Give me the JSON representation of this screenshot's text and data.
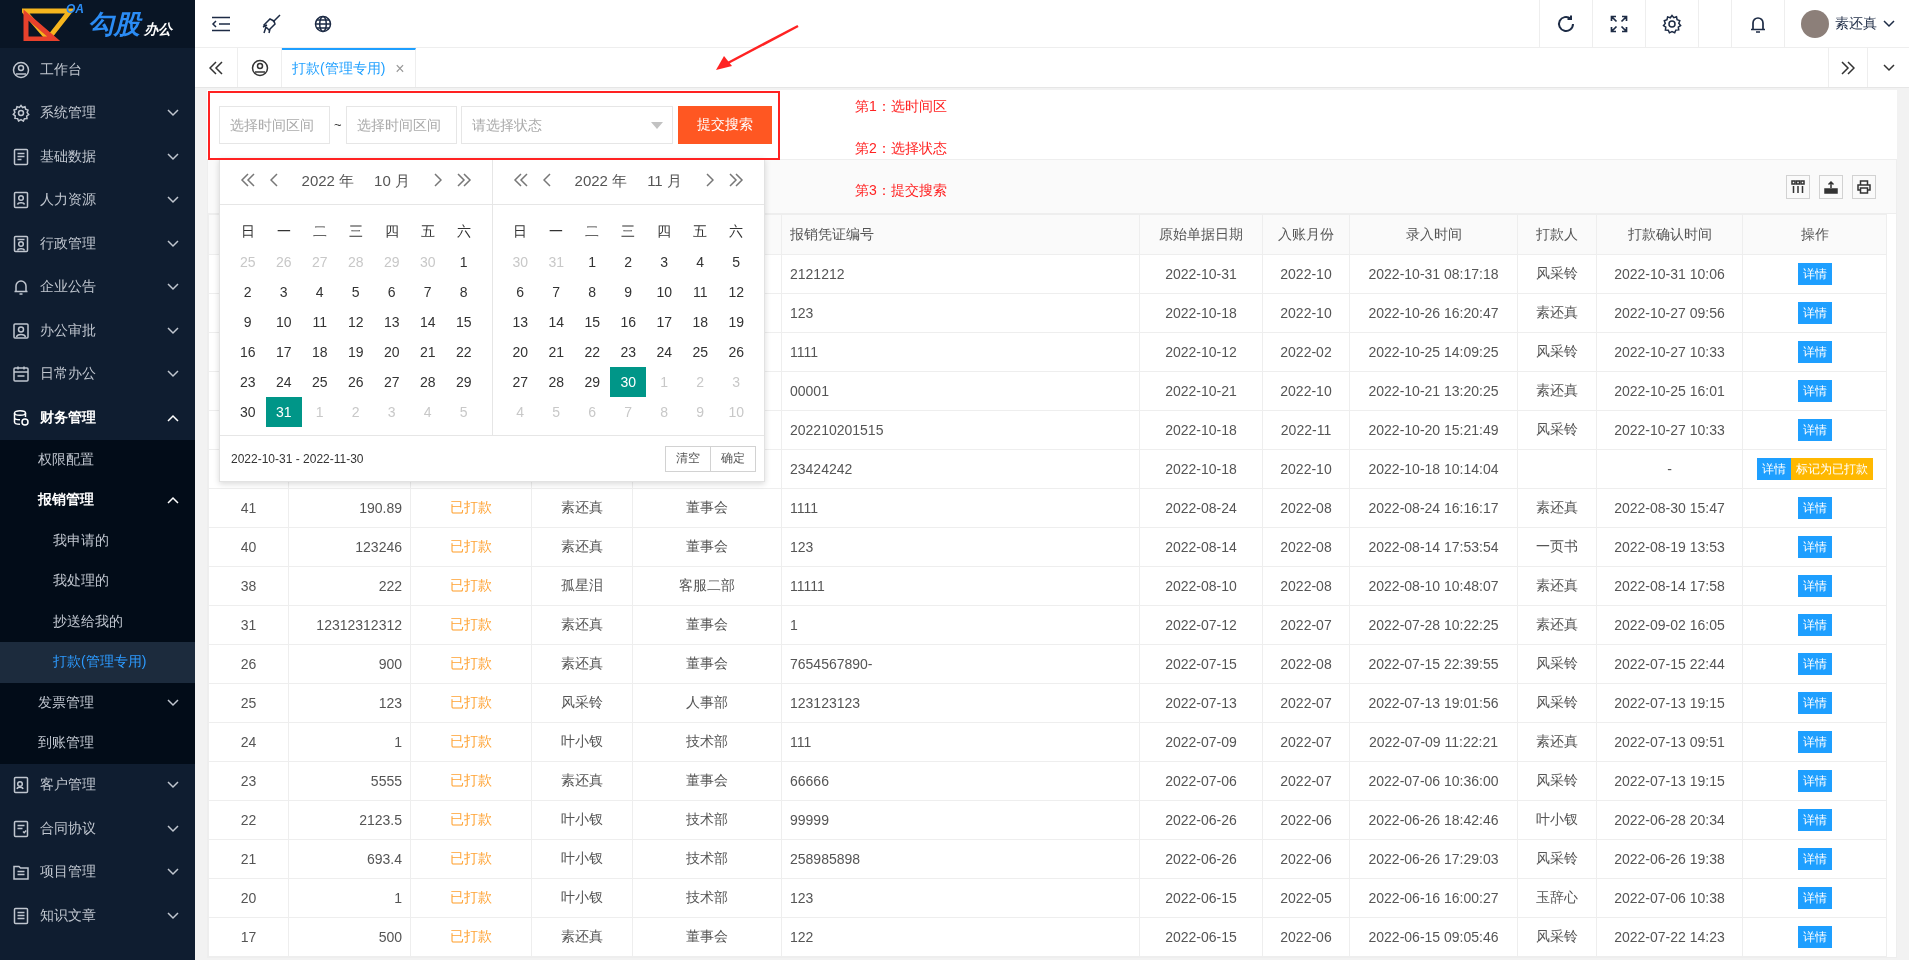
{
  "logo": {
    "superscript": "OA",
    "name": "勾股",
    "suffix": "办公"
  },
  "sidebar": {
    "items": [
      {
        "label": "工作台",
        "expandable": false,
        "expanded": false,
        "selected": false
      },
      {
        "label": "系统管理",
        "expandable": true,
        "expanded": false,
        "selected": false
      },
      {
        "label": "基础数据",
        "expandable": true,
        "expanded": false,
        "selected": false
      },
      {
        "label": "人力资源",
        "expandable": true,
        "expanded": false,
        "selected": false
      },
      {
        "label": "行政管理",
        "expandable": true,
        "expanded": false,
        "selected": false
      },
      {
        "label": "企业公告",
        "expandable": true,
        "expanded": false,
        "selected": false
      },
      {
        "label": "办公审批",
        "expandable": true,
        "expanded": false,
        "selected": false
      },
      {
        "label": "日常办公",
        "expandable": true,
        "expanded": false,
        "selected": false
      },
      {
        "label": "财务管理",
        "expandable": true,
        "expanded": true,
        "selected": false,
        "children": [
          {
            "label": "权限配置",
            "expandable": false,
            "expanded": false,
            "selected": false
          },
          {
            "label": "报销管理",
            "expandable": true,
            "expanded": true,
            "selected": false,
            "children": [
              {
                "label": "我申请的",
                "expandable": false,
                "expanded": false,
                "selected": false
              },
              {
                "label": "我处理的",
                "expandable": false,
                "expanded": false,
                "selected": false
              },
              {
                "label": "抄送给我的",
                "expandable": false,
                "expanded": false,
                "selected": false
              },
              {
                "label": "打款(管理专用)",
                "expandable": false,
                "expanded": false,
                "selected": true
              }
            ]
          },
          {
            "label": "发票管理",
            "expandable": true,
            "expanded": false,
            "selected": false
          },
          {
            "label": "到账管理",
            "expandable": false,
            "expanded": false,
            "selected": false
          }
        ]
      },
      {
        "label": "客户管理",
        "expandable": true,
        "expanded": false,
        "selected": false
      },
      {
        "label": "合同协议",
        "expandable": true,
        "expanded": false,
        "selected": false
      },
      {
        "label": "项目管理",
        "expandable": true,
        "expanded": false,
        "selected": false
      },
      {
        "label": "知识文章",
        "expandable": true,
        "expanded": false,
        "selected": false
      }
    ]
  },
  "header": {
    "user": "素还真"
  },
  "tabs": [
    {
      "label": "打款(管理专用)",
      "selected": true,
      "close": "×"
    }
  ],
  "search_form": {
    "start_placeholder": "选择时间区间",
    "separator": "~",
    "end_placeholder": "选择时间区间",
    "status_placeholder": "请选择状态",
    "submit": "提交搜索"
  },
  "date_picker": {
    "months": [
      {
        "year": "2022 年",
        "month": "10 月",
        "weekdays": [
          "日",
          "一",
          "二",
          "三",
          "四",
          "五",
          "六"
        ],
        "days": [
          {
            "t": "25",
            "muted": true,
            "selected": false
          },
          {
            "t": "26",
            "muted": true,
            "selected": false
          },
          {
            "t": "27",
            "muted": true,
            "selected": false
          },
          {
            "t": "28",
            "muted": true,
            "selected": false
          },
          {
            "t": "29",
            "muted": true,
            "selected": false
          },
          {
            "t": "30",
            "muted": true,
            "selected": false
          },
          {
            "t": "1",
            "muted": false,
            "selected": false
          },
          {
            "t": "2",
            "muted": false,
            "selected": false
          },
          {
            "t": "3",
            "muted": false,
            "selected": false
          },
          {
            "t": "4",
            "muted": false,
            "selected": false
          },
          {
            "t": "5",
            "muted": false,
            "selected": false
          },
          {
            "t": "6",
            "muted": false,
            "selected": false
          },
          {
            "t": "7",
            "muted": false,
            "selected": false
          },
          {
            "t": "8",
            "muted": false,
            "selected": false
          },
          {
            "t": "9",
            "muted": false,
            "selected": false
          },
          {
            "t": "10",
            "muted": false,
            "selected": false
          },
          {
            "t": "11",
            "muted": false,
            "selected": false
          },
          {
            "t": "12",
            "muted": false,
            "selected": false
          },
          {
            "t": "13",
            "muted": false,
            "selected": false
          },
          {
            "t": "14",
            "muted": false,
            "selected": false
          },
          {
            "t": "15",
            "muted": false,
            "selected": false
          },
          {
            "t": "16",
            "muted": false,
            "selected": false
          },
          {
            "t": "17",
            "muted": false,
            "selected": false
          },
          {
            "t": "18",
            "muted": false,
            "selected": false
          },
          {
            "t": "19",
            "muted": false,
            "selected": false
          },
          {
            "t": "20",
            "muted": false,
            "selected": false
          },
          {
            "t": "21",
            "muted": false,
            "selected": false
          },
          {
            "t": "22",
            "muted": false,
            "selected": false
          },
          {
            "t": "23",
            "muted": false,
            "selected": false
          },
          {
            "t": "24",
            "muted": false,
            "selected": false
          },
          {
            "t": "25",
            "muted": false,
            "selected": false
          },
          {
            "t": "26",
            "muted": false,
            "selected": false
          },
          {
            "t": "27",
            "muted": false,
            "selected": false
          },
          {
            "t": "28",
            "muted": false,
            "selected": false
          },
          {
            "t": "29",
            "muted": false,
            "selected": false
          },
          {
            "t": "30",
            "muted": false,
            "selected": false
          },
          {
            "t": "31",
            "muted": false,
            "selected": true
          },
          {
            "t": "1",
            "muted": true,
            "selected": false
          },
          {
            "t": "2",
            "muted": true,
            "selected": false
          },
          {
            "t": "3",
            "muted": true,
            "selected": false
          },
          {
            "t": "4",
            "muted": true,
            "selected": false
          },
          {
            "t": "5",
            "muted": true,
            "selected": false
          }
        ]
      },
      {
        "year": "2022 年",
        "month": "11 月",
        "weekdays": [
          "日",
          "一",
          "二",
          "三",
          "四",
          "五",
          "六"
        ],
        "days": [
          {
            "t": "30",
            "muted": true,
            "selected": false
          },
          {
            "t": "31",
            "muted": true,
            "selected": false
          },
          {
            "t": "1",
            "muted": false,
            "selected": false
          },
          {
            "t": "2",
            "muted": false,
            "selected": false
          },
          {
            "t": "3",
            "muted": false,
            "selected": false
          },
          {
            "t": "4",
            "muted": false,
            "selected": false
          },
          {
            "t": "5",
            "muted": false,
            "selected": false
          },
          {
            "t": "6",
            "muted": false,
            "selected": false
          },
          {
            "t": "7",
            "muted": false,
            "selected": false
          },
          {
            "t": "8",
            "muted": false,
            "selected": false
          },
          {
            "t": "9",
            "muted": false,
            "selected": false
          },
          {
            "t": "10",
            "muted": false,
            "selected": false
          },
          {
            "t": "11",
            "muted": false,
            "selected": false
          },
          {
            "t": "12",
            "muted": false,
            "selected": false
          },
          {
            "t": "13",
            "muted": false,
            "selected": false
          },
          {
            "t": "14",
            "muted": false,
            "selected": false
          },
          {
            "t": "15",
            "muted": false,
            "selected": false
          },
          {
            "t": "16",
            "muted": false,
            "selected": false
          },
          {
            "t": "17",
            "muted": false,
            "selected": false
          },
          {
            "t": "18",
            "muted": false,
            "selected": false
          },
          {
            "t": "19",
            "muted": false,
            "selected": false
          },
          {
            "t": "20",
            "muted": false,
            "selected": false
          },
          {
            "t": "21",
            "muted": false,
            "selected": false
          },
          {
            "t": "22",
            "muted": false,
            "selected": false
          },
          {
            "t": "23",
            "muted": false,
            "selected": false
          },
          {
            "t": "24",
            "muted": false,
            "selected": false
          },
          {
            "t": "25",
            "muted": false,
            "selected": false
          },
          {
            "t": "26",
            "muted": false,
            "selected": false
          },
          {
            "t": "27",
            "muted": false,
            "selected": false
          },
          {
            "t": "28",
            "muted": false,
            "selected": false
          },
          {
            "t": "29",
            "muted": false,
            "selected": false
          },
          {
            "t": "30",
            "muted": false,
            "selected": true
          },
          {
            "t": "1",
            "muted": true,
            "selected": false
          },
          {
            "t": "2",
            "muted": true,
            "selected": false
          },
          {
            "t": "3",
            "muted": true,
            "selected": false
          },
          {
            "t": "4",
            "muted": true,
            "selected": false
          },
          {
            "t": "5",
            "muted": true,
            "selected": false
          },
          {
            "t": "6",
            "muted": true,
            "selected": false
          },
          {
            "t": "7",
            "muted": true,
            "selected": false
          },
          {
            "t": "8",
            "muted": true,
            "selected": false
          },
          {
            "t": "9",
            "muted": true,
            "selected": false
          },
          {
            "t": "10",
            "muted": true,
            "selected": false
          }
        ]
      }
    ],
    "range": "2022-10-31 - 2022-11-30",
    "buttons": [
      "清空",
      "确定"
    ]
  },
  "annotations": [
    "第1：选时间区",
    "第2：选择状态",
    "第3：提交搜索"
  ],
  "table": {
    "columns": [
      "报销凭证编号",
      "原始单据日期",
      "入账月份",
      "录入时间",
      "打款人",
      "打款确认时间",
      "操作"
    ],
    "rows": [
      {
        "voucher_no": "2121212",
        "document_date": "2022-10-31",
        "posting_month": "2022-10",
        "entry_time": "2022-10-31 08:17:18",
        "payer": "风采铃",
        "confirm_time": "2022-10-31 10:06",
        "actions": [
          {
            "label": "详情",
            "kind": "detail"
          }
        ]
      },
      {
        "voucher_no": "123",
        "document_date": "2022-10-18",
        "posting_month": "2022-10",
        "entry_time": "2022-10-26 16:20:47",
        "payer": "素还真",
        "confirm_time": "2022-10-27 09:56",
        "actions": [
          {
            "label": "详情",
            "kind": "detail"
          }
        ]
      },
      {
        "voucher_no": "1111",
        "document_date": "2022-10-12",
        "posting_month": "2022-02",
        "entry_time": "2022-10-25 14:09:25",
        "payer": "风采铃",
        "confirm_time": "2022-10-27 10:33",
        "actions": [
          {
            "label": "详情",
            "kind": "detail"
          }
        ]
      },
      {
        "voucher_no": "00001",
        "document_date": "2022-10-21",
        "posting_month": "2022-10",
        "entry_time": "2022-10-21 13:20:25",
        "payer": "素还真",
        "confirm_time": "2022-10-25 16:01",
        "actions": [
          {
            "label": "详情",
            "kind": "detail"
          }
        ]
      },
      {
        "voucher_no": "202210201515",
        "document_date": "2022-10-18",
        "posting_month": "2022-11",
        "entry_time": "2022-10-20 15:21:49",
        "payer": "风采铃",
        "confirm_time": "2022-10-27 10:33",
        "actions": [
          {
            "label": "详情",
            "kind": "detail"
          }
        ]
      },
      {
        "voucher_no": "23424242",
        "document_date": "2022-10-18",
        "posting_month": "2022-10",
        "entry_time": "2022-10-18 10:14:04",
        "confirm_time": "-",
        "actions": [
          {
            "label": "详情",
            "kind": "detail"
          },
          {
            "label": "标记为已打款",
            "kind": "mark_paid"
          }
        ]
      },
      {
        "column_1": "41",
        "column_2": "190.89",
        "column_3": "已打款",
        "column_4": "素还真",
        "column_5": "董事会",
        "voucher_no": "1111",
        "document_date": "2022-08-24",
        "posting_month": "2022-08",
        "entry_time": "2022-08-24 16:16:17",
        "payer": "素还真",
        "confirm_time": "2022-08-30 15:47",
        "actions": [
          {
            "label": "详情",
            "kind": "detail"
          }
        ]
      },
      {
        "column_1": "40",
        "column_2": "123246",
        "column_3": "已打款",
        "column_4": "素还真",
        "column_5": "董事会",
        "voucher_no": "123",
        "document_date": "2022-08-14",
        "posting_month": "2022-08",
        "entry_time": "2022-08-14 17:53:54",
        "payer": "一页书",
        "confirm_time": "2022-08-19 13:53",
        "actions": [
          {
            "label": "详情",
            "kind": "detail"
          }
        ]
      },
      {
        "column_1": "38",
        "column_2": "222",
        "column_3": "已打款",
        "column_4": "孤星泪",
        "column_5": "客服二部",
        "voucher_no": "11111",
        "document_date": "2022-08-10",
        "posting_month": "2022-08",
        "entry_time": "2022-08-10 10:48:07",
        "payer": "素还真",
        "confirm_time": "2022-08-14 17:58",
        "actions": [
          {
            "label": "详情",
            "kind": "detail"
          }
        ]
      },
      {
        "column_1": "31",
        "column_2": "12312312312",
        "column_3": "已打款",
        "column_4": "素还真",
        "column_5": "董事会",
        "voucher_no": "1",
        "document_date": "2022-07-12",
        "posting_month": "2022-07",
        "entry_time": "2022-07-28 10:22:25",
        "payer": "素还真",
        "confirm_time": "2022-09-02 16:05",
        "actions": [
          {
            "label": "详情",
            "kind": "detail"
          }
        ]
      },
      {
        "column_1": "26",
        "column_2": "900",
        "column_3": "已打款",
        "column_4": "素还真",
        "column_5": "董事会",
        "voucher_no": "7654567890-",
        "document_date": "2022-07-15",
        "posting_month": "2022-08",
        "entry_time": "2022-07-15 22:39:55",
        "payer": "风采铃",
        "confirm_time": "2022-07-15 22:44",
        "actions": [
          {
            "label": "详情",
            "kind": "detail"
          }
        ]
      },
      {
        "column_1": "25",
        "column_2": "123",
        "column_3": "已打款",
        "column_4": "风采铃",
        "column_5": "人事部",
        "voucher_no": "123123123",
        "document_date": "2022-07-13",
        "posting_month": "2022-07",
        "entry_time": "2022-07-13 19:01:56",
        "payer": "风采铃",
        "confirm_time": "2022-07-13 19:15",
        "actions": [
          {
            "label": "详情",
            "kind": "detail"
          }
        ]
      },
      {
        "column_1": "24",
        "column_2": "1",
        "column_3": "已打款",
        "column_4": "叶小钗",
        "column_5": "技术部",
        "voucher_no": "111",
        "document_date": "2022-07-09",
        "posting_month": "2022-07",
        "entry_time": "2022-07-09 11:22:21",
        "payer": "素还真",
        "confirm_time": "2022-07-13 09:51",
        "actions": [
          {
            "label": "详情",
            "kind": "detail"
          }
        ]
      },
      {
        "column_1": "23",
        "column_2": "5555",
        "column_3": "已打款",
        "column_4": "素还真",
        "column_5": "董事会",
        "voucher_no": "66666",
        "document_date": "2022-07-06",
        "posting_month": "2022-07",
        "entry_time": "2022-07-06 10:36:00",
        "payer": "风采铃",
        "confirm_time": "2022-07-13 19:15",
        "actions": [
          {
            "label": "详情",
            "kind": "detail"
          }
        ]
      },
      {
        "column_1": "22",
        "column_2": "2123.5",
        "column_3": "已打款",
        "column_4": "叶小钗",
        "column_5": "技术部",
        "voucher_no": "99999",
        "document_date": "2022-06-26",
        "posting_month": "2022-06",
        "entry_time": "2022-06-26 18:42:46",
        "payer": "叶小钗",
        "confirm_time": "2022-06-28 20:34",
        "actions": [
          {
            "label": "详情",
            "kind": "detail"
          }
        ]
      },
      {
        "column_1": "21",
        "column_2": "693.4",
        "column_3": "已打款",
        "column_4": "叶小钗",
        "column_5": "技术部",
        "voucher_no": "258985898",
        "document_date": "2022-06-26",
        "posting_month": "2022-06",
        "entry_time": "2022-06-26 17:29:03",
        "payer": "风采铃",
        "confirm_time": "2022-06-26 19:38",
        "actions": [
          {
            "label": "详情",
            "kind": "detail"
          }
        ]
      },
      {
        "column_1": "20",
        "column_2": "1",
        "column_3": "已打款",
        "column_4": "叶小钗",
        "column_5": "技术部",
        "voucher_no": "123",
        "document_date": "2022-06-15",
        "posting_month": "2022-05",
        "entry_time": "2022-06-16 16:00:27",
        "payer": "玉辞心",
        "confirm_time": "2022-07-06 10:38",
        "actions": [
          {
            "label": "详情",
            "kind": "detail"
          }
        ]
      },
      {
        "column_1": "17",
        "column_2": "500",
        "column_3": "已打款",
        "column_4": "素还真",
        "column_5": "董事会",
        "voucher_no": "122",
        "document_date": "2022-06-15",
        "posting_month": "2022-06",
        "entry_time": "2022-06-15 09:05:46",
        "payer": "风采铃",
        "confirm_time": "2022-07-22 14:23",
        "actions": [
          {
            "label": "详情",
            "kind": "detail"
          }
        ]
      }
    ]
  }
}
